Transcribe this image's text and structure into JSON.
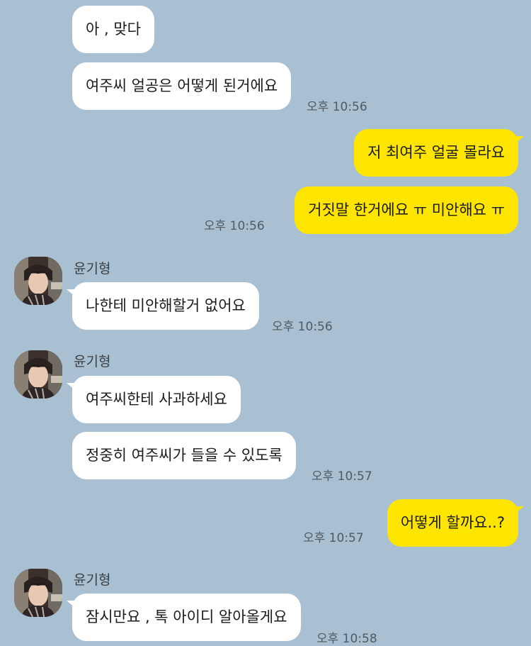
{
  "colors": {
    "background": "#a9c0d2",
    "incoming_bubble": "#ffffff",
    "outgoing_bubble": "#fee500",
    "timestamp": "#4f5a63"
  },
  "messages": [
    {
      "text": "아 , 맞다"
    },
    {
      "text": "여주씨 얼공은 어떻게 된거에요",
      "time": "오후 10:56"
    },
    {
      "text": "저 최여주 얼굴 몰라요"
    },
    {
      "text": "거짓말 한거에요 ㅠ 미안해요 ㅠ",
      "time": "오후 10:56"
    },
    {
      "sender": "윤기형",
      "text": "나한테 미안해할거 없어요",
      "time": "오후 10:56"
    },
    {
      "sender": "윤기형",
      "text": "여주씨한테 사과하세요"
    },
    {
      "text": "정중히 여주씨가 들을 수 있도록",
      "time": "오후 10:57"
    },
    {
      "text": "어떻게 할까요..?",
      "time": "오후 10:57"
    },
    {
      "sender": "윤기형",
      "text": "잠시만요 , 톡 아이디 알아올게요",
      "time": "오후 10:58"
    }
  ]
}
